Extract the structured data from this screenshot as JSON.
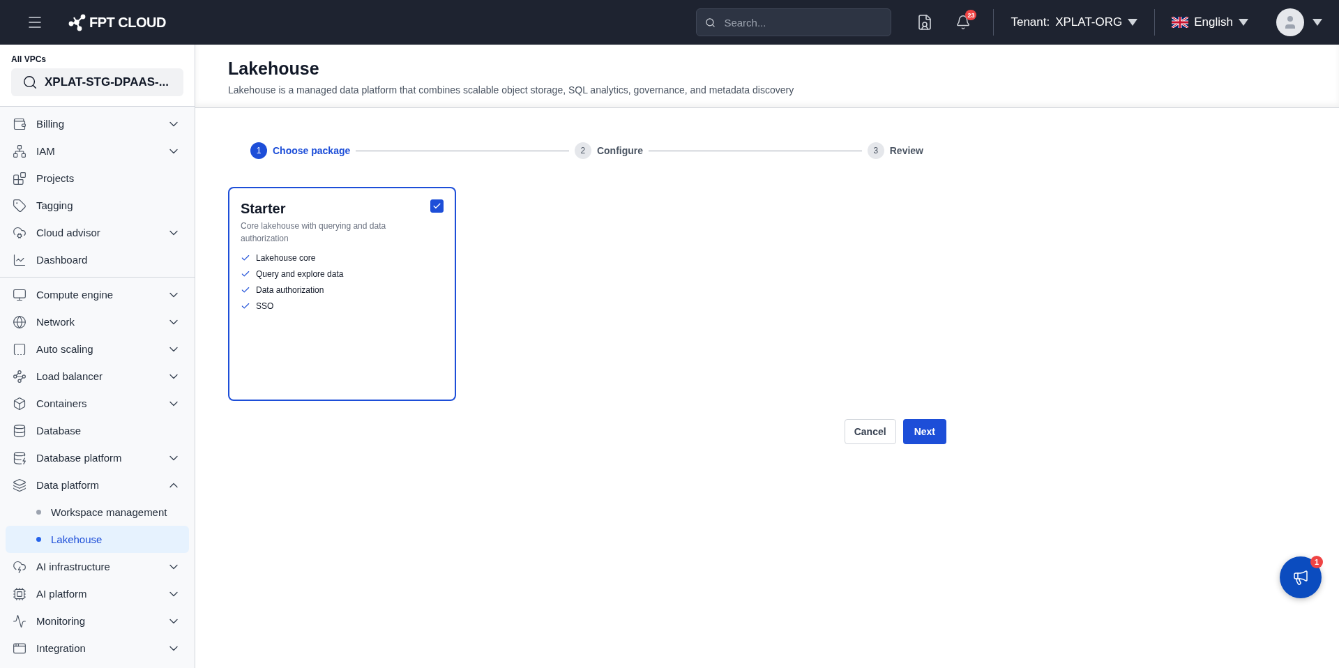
{
  "header": {
    "logo": "FPT CLOUD",
    "search": {
      "placeholder": "Search..."
    },
    "notifications": {
      "count": "23"
    },
    "tenant": {
      "label": "Tenant:",
      "value": "XPLAT-ORG"
    },
    "language": "English"
  },
  "sidebar": {
    "vpc_label": "All VPCs",
    "vpc_value": "XPLAT-STG-DPAAS-...",
    "groups": [
      [
        {
          "label": "Billing",
          "kind": "group",
          "expanded": false
        },
        {
          "label": "IAM",
          "kind": "group",
          "expanded": false
        },
        {
          "label": "Projects",
          "kind": "link"
        },
        {
          "label": "Tagging",
          "kind": "link"
        },
        {
          "label": "Cloud advisor",
          "kind": "group",
          "expanded": false
        },
        {
          "label": "Dashboard",
          "kind": "link"
        }
      ],
      [
        {
          "label": "Compute engine",
          "kind": "group",
          "expanded": false
        },
        {
          "label": "Network",
          "kind": "group",
          "expanded": false
        },
        {
          "label": "Auto scaling",
          "kind": "group",
          "expanded": false
        },
        {
          "label": "Load balancer",
          "kind": "group",
          "expanded": false
        },
        {
          "label": "Containers",
          "kind": "group",
          "expanded": false
        },
        {
          "label": "Database",
          "kind": "link"
        },
        {
          "label": "Database platform",
          "kind": "group",
          "expanded": false
        },
        {
          "label": "Data platform",
          "kind": "group",
          "expanded": true,
          "children": [
            {
              "label": "Workspace management",
              "selected": false
            },
            {
              "label": "Lakehouse",
              "selected": true
            }
          ]
        },
        {
          "label": "AI infrastructure",
          "kind": "group",
          "expanded": false
        },
        {
          "label": "AI platform",
          "kind": "group",
          "expanded": false
        },
        {
          "label": "Monitoring",
          "kind": "group",
          "expanded": false
        },
        {
          "label": "Integration",
          "kind": "group",
          "expanded": false
        }
      ]
    ]
  },
  "page": {
    "title": "Lakehouse",
    "description": "Lakehouse is a managed data platform that combines scalable object storage, SQL analytics, governance, and metadata discovery",
    "steps": [
      {
        "number": "1",
        "label": "Choose package",
        "selected": true
      },
      {
        "number": "2",
        "label": "Configure",
        "selected": false
      },
      {
        "number": "3",
        "label": "Review",
        "selected": false
      }
    ],
    "packages": [
      {
        "title": "Starter",
        "description": "Core lakehouse with querying and data authorization",
        "checked": true,
        "features": [
          "Lakehouse core",
          "Query and explore data",
          "Data authorization",
          "SSO"
        ]
      }
    ],
    "buttons": {
      "cancel": "Cancel",
      "next": "Next"
    }
  },
  "announcements": {
    "badge": "1"
  }
}
